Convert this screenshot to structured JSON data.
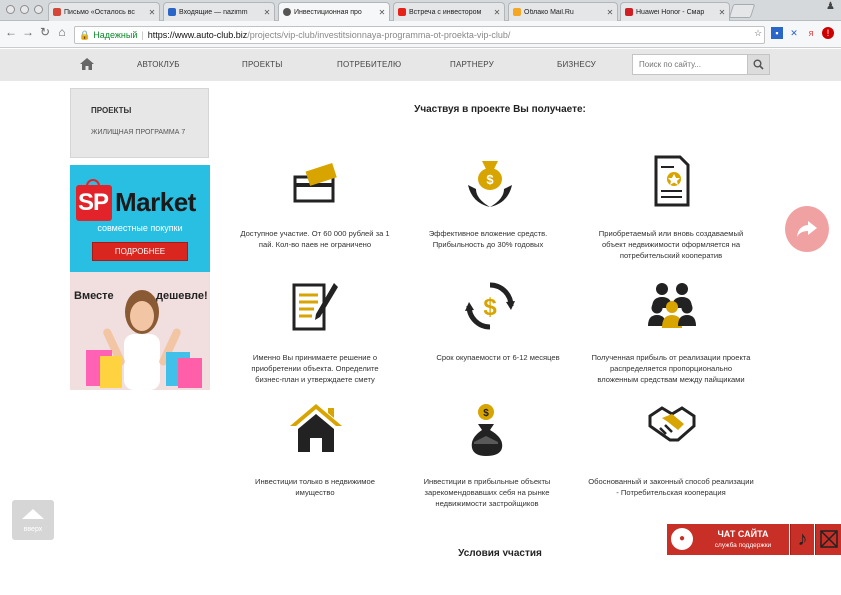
{
  "browser": {
    "tabs": [
      {
        "title": "Письмо «Осталось вс",
        "icon": "gmail-icon",
        "color": "#d44638"
      },
      {
        "title": "Входящие — nazimm",
        "icon": "mail-icon",
        "color": "#2a66c8"
      },
      {
        "title": "Инвестиционная про",
        "icon": "site-icon",
        "color": "#555555"
      },
      {
        "title": "Встреча с инвестором",
        "icon": "youtube-icon",
        "color": "#e62117"
      },
      {
        "title": "Облако Mail.Ru",
        "icon": "cloud-icon",
        "color": "#f5a623"
      },
      {
        "title": "Huawei Honor - Смар",
        "icon": "huawei-icon",
        "color": "#cf1f24"
      }
    ],
    "address": {
      "secure_label": "Надежный",
      "host": "https://www.auto-club.biz",
      "path": "/projects/vip-club/investitsionnaya-programma-ot-proekta-vip-club/"
    }
  },
  "site_nav": {
    "items": [
      "АВТОКЛУБ",
      "ПРОЕКТЫ",
      "ПОТРЕБИТЕЛЮ",
      "ПАРТНЕРУ",
      "БИЗНЕСУ"
    ],
    "search_placeholder": "Поиск по сайту..."
  },
  "sidebar": {
    "heading": "ПРОЕКТЫ",
    "item": "ЖИЛИЩНАЯ ПРОГРАММА 7"
  },
  "banner": {
    "brand_sp": "SP",
    "brand_market": "Market",
    "subtitle": "совместные покупки",
    "button": "ПОДРОБНЕЕ",
    "left_word": "Вместе",
    "right_word": "дешевле!"
  },
  "content": {
    "heading": "Участвуя в проекте Вы получаете:",
    "features": [
      {
        "icon": "wallet-card-icon",
        "text": "Доступное участие. От 60 000 рублей за 1 пай. Кол-во паев не ограничено"
      },
      {
        "icon": "money-bag-hands-icon",
        "text": "Эффективное вложение средств. Прибыльность до 30% годовых"
      },
      {
        "icon": "certificate-icon",
        "text": "Приобретаемый или вновь создаваемый объект недвижимости оформляется на потребительский кооператив"
      },
      {
        "icon": "document-pen-icon",
        "text": "Именно Вы принимаете решение о приобретении объекта. Определите бизнес-план и утверждаете смету"
      },
      {
        "icon": "dollar-cycle-icon",
        "text": "Срок окупаемости от 6-12 месяцев"
      },
      {
        "icon": "people-group-icon",
        "text": "Полученная прибыль от реализации проекта распределяется пропорционально вложенным средствам между пайщиками"
      },
      {
        "icon": "house-icon",
        "text": "Инвестиции только в недвижимое имущество"
      },
      {
        "icon": "money-bag-house-icon",
        "text": "Инвестиции в прибыльные объекты зарекомендовавших себя на рынке недвижимости застройщиков"
      },
      {
        "icon": "handshake-icon",
        "text": "Обоснованный и законный способ реализации - Потребительская кооперация"
      }
    ],
    "next_heading": "Условия участия"
  },
  "widgets": {
    "up_label": "вверх",
    "chat_title": "ЧАТ САЙТА",
    "chat_subtitle": "служба поддержки"
  },
  "colors": {
    "accent_gold": "#d8a400",
    "chat_red": "#c72f27",
    "share_pink": "#f0a2a2",
    "banner_blue": "#28bfe3"
  }
}
